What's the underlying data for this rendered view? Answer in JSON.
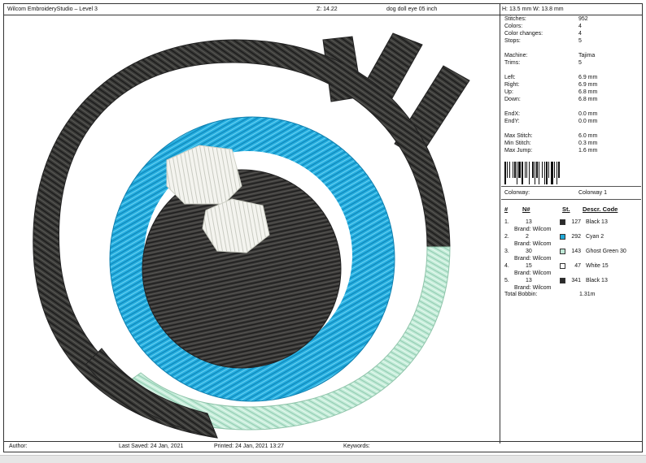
{
  "header": {
    "app_title": "Wilcom EmbroideryStudio – Level 3",
    "zoom": "Z: 14.22",
    "design_name": "dog doll eye 05 inch",
    "height": "H: 13.5 mm",
    "width": "W: 13.8 mm"
  },
  "stats": [
    {
      "label": "Stitches:",
      "value": "952"
    },
    {
      "label": "Colors:",
      "value": "4"
    },
    {
      "label": "Color changes:",
      "value": "4"
    },
    {
      "label": "Stops:",
      "value": "5"
    },
    {
      "label": "Machine:",
      "value": "Tajima"
    },
    {
      "label": "Trims:",
      "value": "5"
    },
    {
      "label": "Left:",
      "value": "6.9 mm"
    },
    {
      "label": "Right:",
      "value": "6.9 mm"
    },
    {
      "label": "Up:",
      "value": "6.8 mm"
    },
    {
      "label": "Down:",
      "value": "6.8 mm"
    },
    {
      "label": "EndX:",
      "value": "0.0 mm"
    },
    {
      "label": "EndY:",
      "value": "0.0 mm"
    },
    {
      "label": "Max Stitch:",
      "value": "6.0 mm"
    },
    {
      "label": "Min Stitch:",
      "value": "0.3 mm"
    },
    {
      "label": "Max Jump:",
      "value": "1.6 mm"
    }
  ],
  "colorway": {
    "label": "Colorway:",
    "value": "Colorway 1"
  },
  "table_headers": {
    "num": "#",
    "n": "N#",
    "st": "St.",
    "descr": "Descr. Code"
  },
  "threads": [
    {
      "idx": "1.",
      "n": "13",
      "st": "127",
      "descr": "Black 13",
      "brand": "Brand: Wilcom",
      "color": "#2b2b2b"
    },
    {
      "idx": "2.",
      "n": "2",
      "st": "292",
      "descr": "Cyan 2",
      "brand": "Brand: Wilcom",
      "color": "#1fa9d8"
    },
    {
      "idx": "3.",
      "n": "30",
      "st": "143",
      "descr": "Ghost Green 30",
      "brand": "Brand: Wilcom",
      "color": "#bfe8d6"
    },
    {
      "idx": "4.",
      "n": "15",
      "st": "47",
      "descr": "White 15",
      "brand": "Brand: Wilcom",
      "color": "#ffffff"
    },
    {
      "idx": "5.",
      "n": "13",
      "st": "341",
      "descr": "Black 13",
      "brand": "Brand: Wilcom",
      "color": "#2b2b2b"
    }
  ],
  "total_bobbin": {
    "label": "Total Bobbin:",
    "value": "1.31m"
  },
  "footer": {
    "author": "Author:",
    "last_saved": "Last Saved: 24 Jan, 2021",
    "printed": "Printed: 24 Jan, 2021 13:27",
    "keywords": "Keywords:"
  }
}
